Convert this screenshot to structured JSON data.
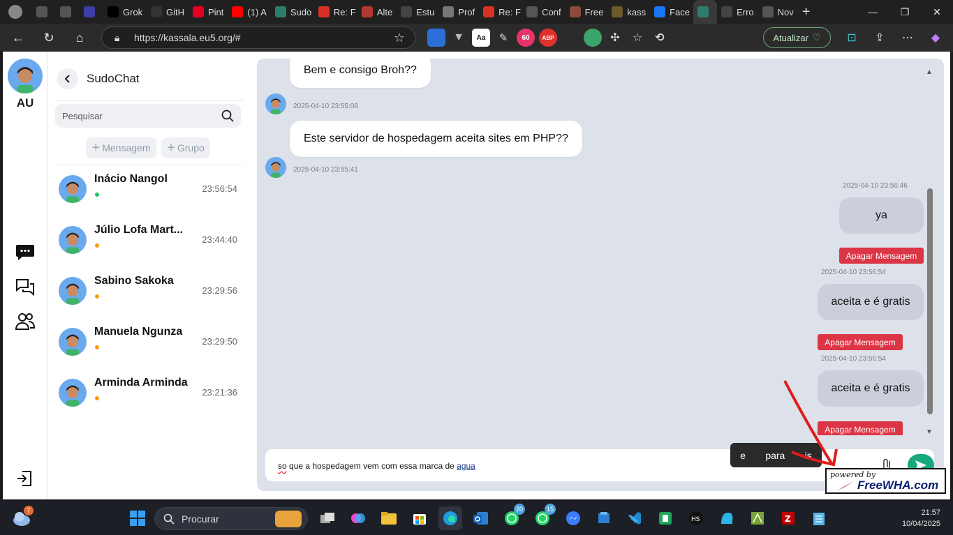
{
  "browser": {
    "tabs": [
      {
        "label": "",
        "icon": "workspaces-icon",
        "color": "#555555"
      },
      {
        "label": "",
        "icon": "tab-actions-icon",
        "color": "#555555"
      },
      {
        "label": "",
        "icon": "shield-icon",
        "color": "#3b3fa6"
      },
      {
        "label": "Grok",
        "icon": "x-icon",
        "color": "#000000"
      },
      {
        "label": "GitH",
        "icon": "github-icon",
        "color": "#333333"
      },
      {
        "label": "Pint",
        "icon": "pinterest-icon",
        "color": "#e60023"
      },
      {
        "label": "(1) A",
        "icon": "youtube-icon",
        "color": "#ff0000"
      },
      {
        "label": "Sudo",
        "icon": "sudo-icon",
        "color": "#2e7d6b"
      },
      {
        "label": "Re: F",
        "icon": "gmail-icon",
        "color": "#d93025"
      },
      {
        "label": "Alte",
        "icon": "gmail-icon",
        "color": "#b03a30"
      },
      {
        "label": "Estu",
        "icon": "openai-icon",
        "color": "#444444"
      },
      {
        "label": "Prof",
        "icon": "site-icon",
        "color": "#777777"
      },
      {
        "label": "Re: F",
        "icon": "gmail-icon",
        "color": "#d93025"
      },
      {
        "label": "Conf",
        "icon": "globe-icon",
        "color": "#555555"
      },
      {
        "label": "Free",
        "icon": "free-icon",
        "color": "#8a4b3a"
      },
      {
        "label": "kass",
        "icon": "kassala-icon",
        "color": "#6b5a2a"
      },
      {
        "label": "Face",
        "icon": "facebook-icon",
        "color": "#1877f2"
      },
      {
        "label": "",
        "icon": "sudo-icon",
        "color": "#2e7d6b",
        "active": true
      },
      {
        "label": "Erro",
        "icon": "openai-icon",
        "color": "#444444"
      },
      {
        "label": "Nov",
        "icon": "newtab-icon",
        "color": "#555555"
      }
    ],
    "url": "https://kassala.eu5.org/#",
    "atualizar_label": "Atualizar"
  },
  "sidebar": {
    "title": "SudoChat",
    "user_initials": "AU",
    "search_placeholder": "Pesquisar",
    "new_message_label": "Mensagem",
    "new_group_label": "Grupo",
    "contacts": [
      {
        "name": "Inácio Nangol",
        "time": "23:56:54",
        "status_color": "#22c55e"
      },
      {
        "name": "Júlio Lofa Mart...",
        "time": "23:44:40",
        "status_color": "#f59e0b"
      },
      {
        "name": "Sabino Sakoka",
        "time": "23:29:56",
        "status_color": "#f59e0b"
      },
      {
        "name": "Manuela Ngunza",
        "time": "23:29:50",
        "status_color": "#f59e0b"
      },
      {
        "name": "Arminda Arminda",
        "time": "23:21:36",
        "status_color": "#f59e0b"
      }
    ]
  },
  "chat": {
    "messages": [
      {
        "direction": "in",
        "text": "Bem e consigo Broh??",
        "time": "2025-04-10 23:55:08"
      },
      {
        "direction": "in",
        "text": "Este servidor de hospedagem aceita sites em PHP??",
        "time": "2025-04-10 23:55:41"
      },
      {
        "direction": "out",
        "text": "ya",
        "time": "2025-04-10 23:56:46",
        "delete_label": "Apagar Mensagem"
      },
      {
        "direction": "out",
        "text": "aceita e é gratis",
        "time": "2025-04-10 23:56:54",
        "delete_label": "Apagar Mensagem"
      },
      {
        "direction": "out",
        "text": "aceita e é gratis",
        "time": "2025-04-10 23:56:54",
        "delete_label": "Apagar Mensagem"
      }
    ],
    "composer": {
      "text_parts": [
        "so",
        " que a hospedagem vem com essa marca de ",
        "agua"
      ]
    },
    "suggestions": [
      "e",
      "para",
      "is"
    ]
  },
  "watermark": {
    "line1": "powered by",
    "line2": "FreeWHA.com"
  },
  "taskbar": {
    "weather_badge": "7",
    "search_label": "Procurar",
    "whatsapp_badge_1": "20",
    "whatsapp_badge_2": "15",
    "time": "21:57",
    "date": "10/04/2025"
  },
  "colors": {
    "accent_send": "#17a97e",
    "delete_button": "#dc3545",
    "chat_bg": "#dde1ea",
    "out_bubble": "#cbcfdc"
  }
}
